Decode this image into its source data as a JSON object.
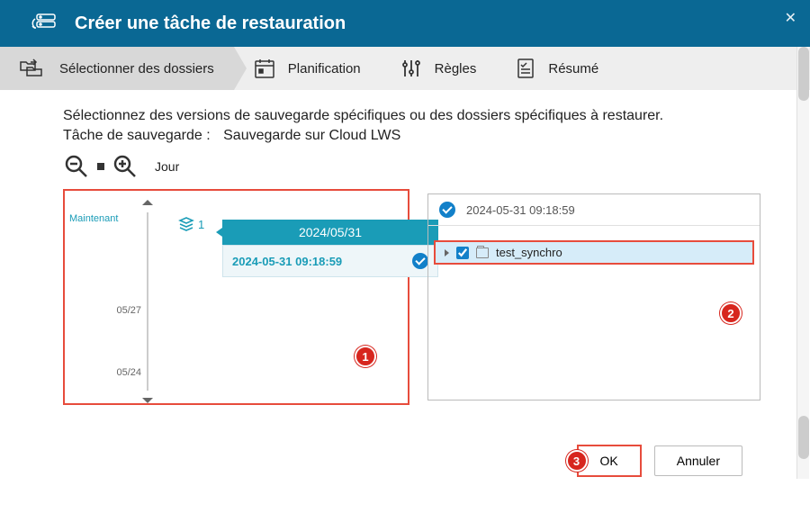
{
  "dialog": {
    "title": "Créer une tâche de restauration"
  },
  "steps": {
    "select_folders": "Sélectionner des dossiers",
    "schedule": "Planification",
    "rules": "Règles",
    "summary": "Résumé"
  },
  "main": {
    "instruction": "Sélectionnez des versions de sauvegarde spécifiques ou des dossiers spécifiques à restaurer.",
    "task_label": "Tâche de sauvegarde :",
    "task_value": "Sauvegarde sur Cloud LWS",
    "time_unit": "Jour"
  },
  "timeline": {
    "now": "Maintenant",
    "layer_count": "1",
    "ticks": [
      "05/27",
      "05/24"
    ],
    "group_date": "2024/05/31",
    "version_time": "2024-05-31 09:18:59"
  },
  "right": {
    "header_time": "2024-05-31 09:18:59",
    "folder_name": "test_synchro"
  },
  "badges": {
    "b1": "1",
    "b2": "2",
    "b3": "3"
  },
  "buttons": {
    "ok": "OK",
    "cancel": "Annuler"
  }
}
